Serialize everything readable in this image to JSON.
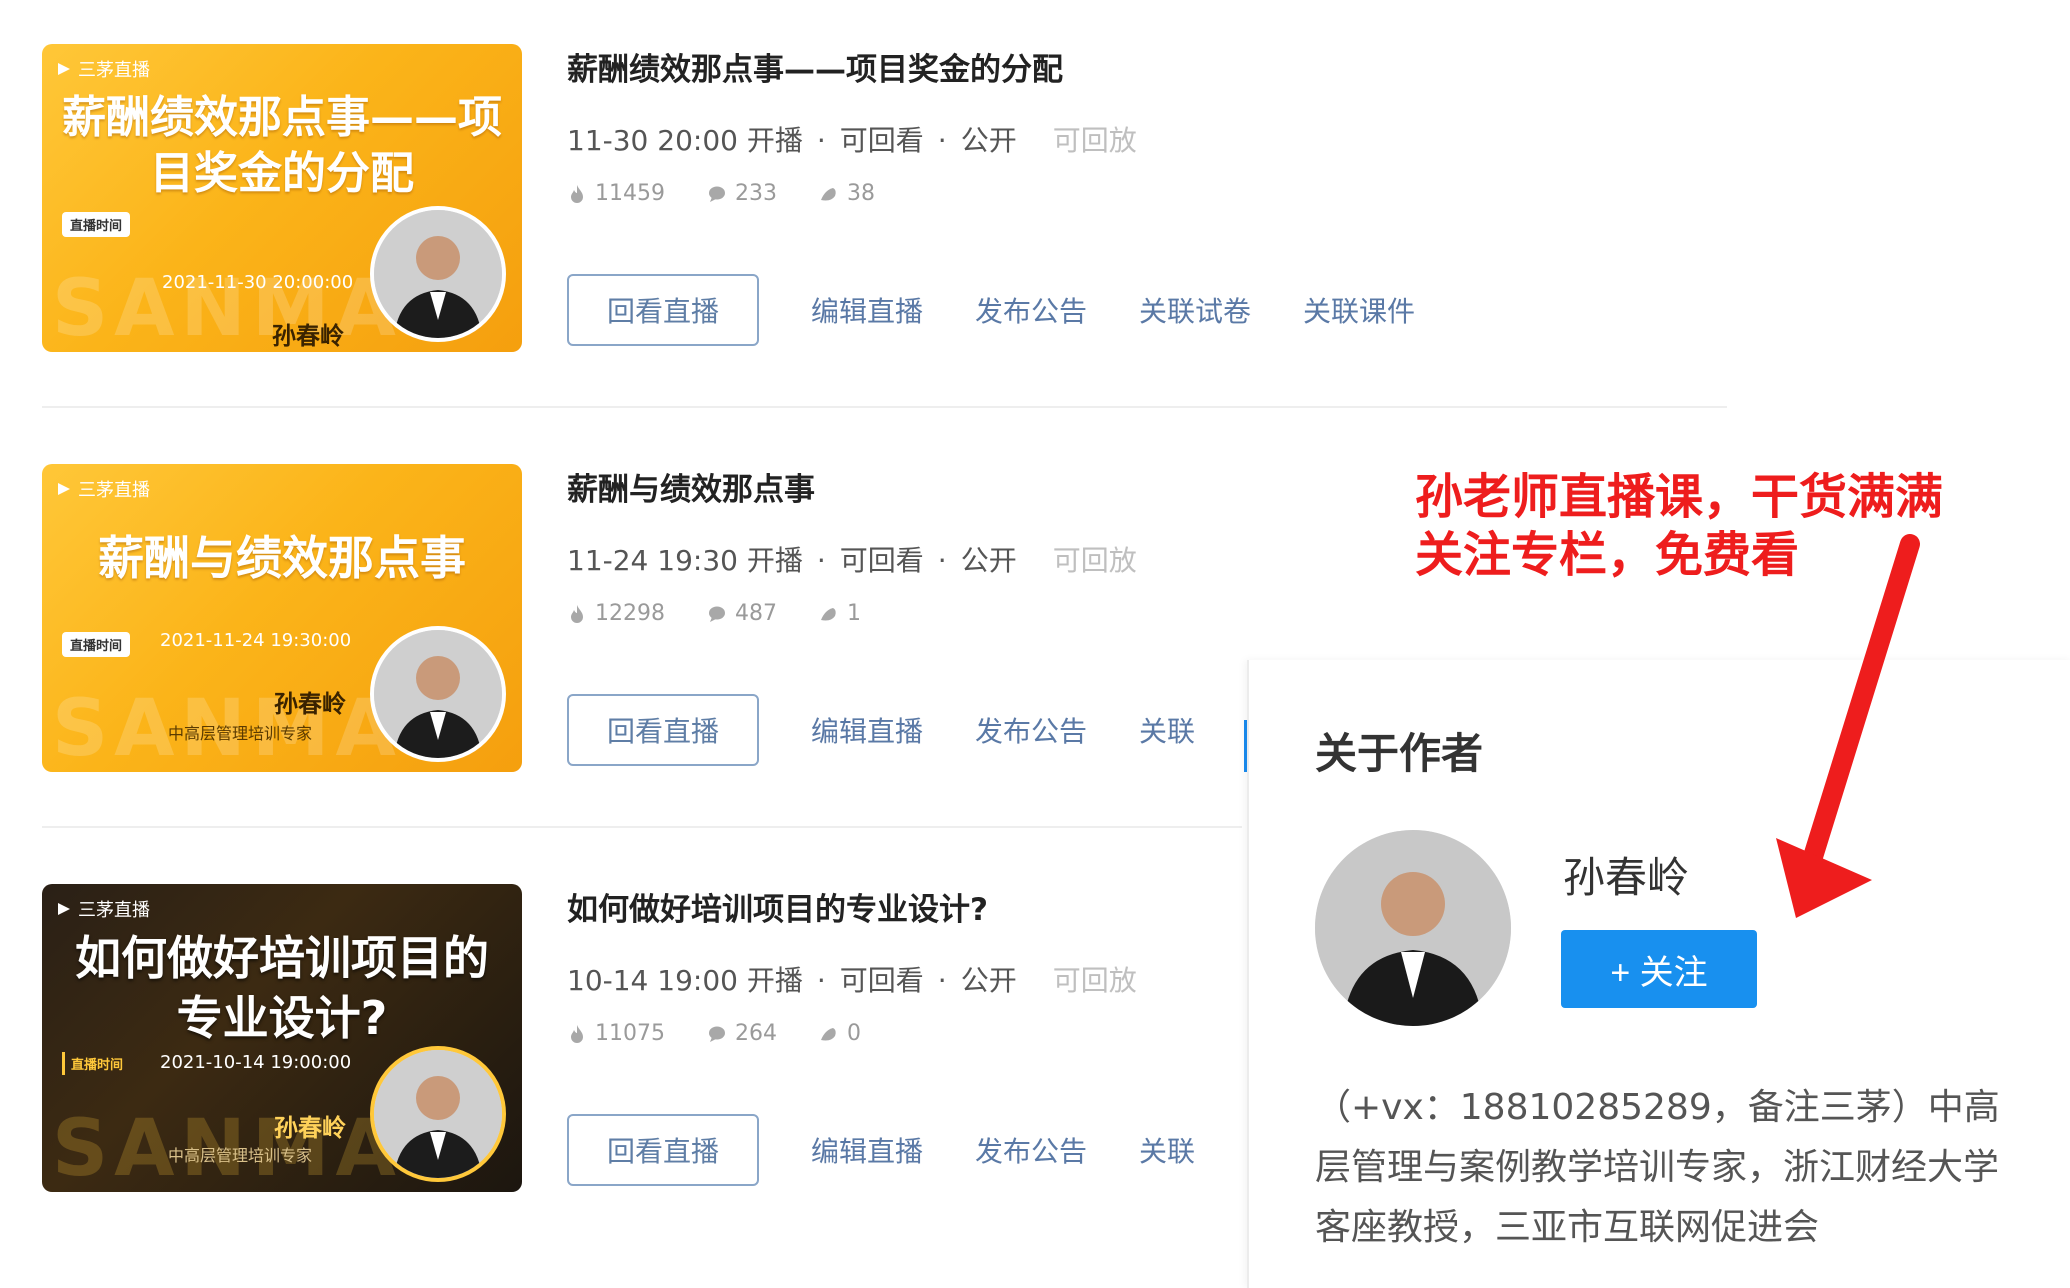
{
  "courses": [
    {
      "thumb": {
        "brand": "三茅直播",
        "title": "薪酬绩效那点事——项目奖金的分配",
        "time_tag": "直播时间",
        "time": "2021-11-30 20:00:00",
        "host": "孙春岭",
        "host_sub": "",
        "watermark": "SANMAO"
      },
      "title": "薪酬绩效那点事——项目奖金的分配",
      "date": "11-30 20:00 开播",
      "playback": "可回看",
      "visibility": "公开",
      "replay_status": "可回放",
      "views": "11459",
      "comments": "233",
      "likes": "38",
      "replay_button": "回看直播",
      "edit": "编辑直播",
      "announce": "发布公告",
      "link_exam": "关联试卷",
      "link_courseware": "关联课件"
    },
    {
      "thumb": {
        "brand": "三茅直播",
        "title": "薪酬与绩效那点事",
        "time_tag": "直播时间",
        "time": "2021-11-24 19:30:00",
        "host": "孙春岭",
        "host_sub": "中高层管理培训专家",
        "watermark": "SANMAO"
      },
      "title": "薪酬与绩效那点事",
      "date": "11-24 19:30 开播",
      "playback": "可回看",
      "visibility": "公开",
      "replay_status": "可回放",
      "views": "12298",
      "comments": "487",
      "likes": "1",
      "replay_button": "回看直播",
      "edit": "编辑直播",
      "announce": "发布公告",
      "link_exam": "关联"
    },
    {
      "thumb": {
        "brand": "三茅直播",
        "title_line1": "如何做好培训项目的",
        "title_line2": "专业设计?",
        "time_tag": "直播时间",
        "time": "2021-10-14 19:00:00",
        "host": "孙春岭",
        "host_sub": "中高层管理培训专家",
        "watermark": "SANMAO"
      },
      "title": "如何做好培训项目的专业设计?",
      "date": "10-14 19:00 开播",
      "playback": "可回看",
      "visibility": "公开",
      "replay_status": "可回放",
      "views": "11075",
      "comments": "264",
      "likes": "0",
      "replay_button": "回看直播",
      "edit": "编辑直播",
      "announce": "发布公告",
      "link_exam": "关联"
    }
  ],
  "callout": {
    "line1": "孙老师直播课，干货满满",
    "line2": "关注专栏，免费看",
    "color": "#ee1d1d"
  },
  "about": {
    "title": "关于作者",
    "name": "孙春岭",
    "follow": "+ 关注",
    "bio": "（+vx：18810285289，备注三茅）中高层管理与案例教学培训专家，浙江财经大学客座教授，三亚市互联网促进会"
  },
  "colors": {
    "accent": "#1890ef",
    "link": "#5a79a6",
    "thumb_orange": "#fbb419"
  }
}
